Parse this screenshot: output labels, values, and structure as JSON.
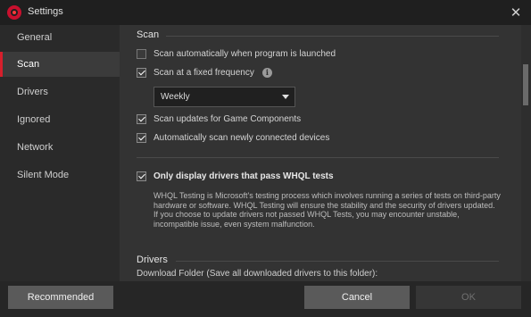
{
  "window": {
    "title": "Settings",
    "close_glyph": "✕"
  },
  "sidebar": {
    "items": [
      {
        "label": "General"
      },
      {
        "label": "Scan"
      },
      {
        "label": "Drivers"
      },
      {
        "label": "Ignored"
      },
      {
        "label": "Network"
      },
      {
        "label": "Silent Mode"
      }
    ],
    "active": "Scan"
  },
  "scan": {
    "title": "Scan",
    "auto_scan_label": "Scan automatically when program is launched",
    "auto_scan_checked": false,
    "fixed_freq_label": "Scan at a fixed frequency",
    "fixed_freq_checked": true,
    "info_glyph": "i",
    "frequency_value": "Weekly",
    "game_components_label": "Scan updates for Game Components",
    "game_components_checked": true,
    "new_devices_label": "Automatically scan newly connected devices",
    "new_devices_checked": true,
    "whql_label": "Only display drivers that pass WHQL tests",
    "whql_checked": true,
    "whql_description": "WHQL Testing is Microsoft's testing process which involves running a series of tests on third-party hardware or software. WHQL Testing will ensure the stability and the security of drivers updated. If you choose to update drivers not passed WHQL Tests, you may encounter unstable, incompatible issue, even system malfunction."
  },
  "drivers": {
    "title": "Drivers",
    "download_folder_label": "Download Folder (Save all downloaded drivers to this folder):"
  },
  "footer": {
    "recommended_label": "Recommended",
    "cancel_label": "Cancel",
    "ok_label": "OK"
  },
  "colors": {
    "accent": "#d61f2c",
    "window_bg": "#333333",
    "sidebar_bg": "#2a2a2a",
    "titlebar_bg": "#1f1f1f"
  }
}
